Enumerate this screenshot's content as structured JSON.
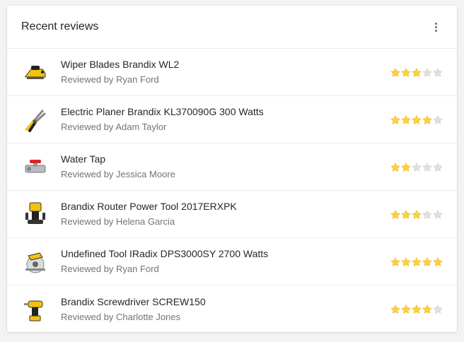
{
  "widget": {
    "title": "Recent reviews",
    "menu_icon": "more-vertical-icon"
  },
  "colors": {
    "star_filled": "#ffd333",
    "star_empty": "#e0e0e0",
    "star_stroke_filled": "#e5b42a"
  },
  "reviews": [
    {
      "product": "Wiper Blades Brandix WL2",
      "reviewer": "Reviewed by Ryan Ford",
      "rating": 3,
      "thumb_icon": "planer-icon"
    },
    {
      "product": "Electric Planer Brandix KL370090G 300 Watts",
      "reviewer": "Reviewed by Adam Taylor",
      "rating": 4,
      "thumb_icon": "pliers-icon"
    },
    {
      "product": "Water Tap",
      "reviewer": "Reviewed by Jessica Moore",
      "rating": 2,
      "thumb_icon": "valve-icon"
    },
    {
      "product": "Brandix Router Power Tool 2017ERXPK",
      "reviewer": "Reviewed by Helena Garcia",
      "rating": 3,
      "thumb_icon": "router-icon"
    },
    {
      "product": "Undefined Tool IRadix DPS3000SY 2700 Watts",
      "reviewer": "Reviewed by Ryan Ford",
      "rating": 5,
      "thumb_icon": "circular-saw-icon"
    },
    {
      "product": "Brandix Screwdriver SCREW150",
      "reviewer": "Reviewed by Charlotte Jones",
      "rating": 4,
      "thumb_icon": "drill-icon"
    }
  ]
}
